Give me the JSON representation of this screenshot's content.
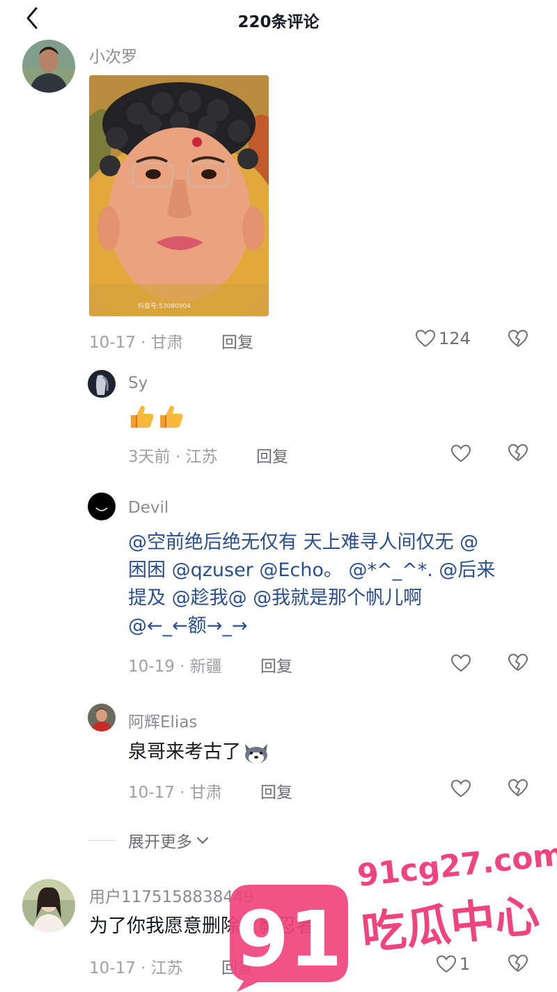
{
  "header": {
    "title": "220条评论"
  },
  "comments": [
    {
      "user": "小次罗",
      "time": "10-17",
      "location": "甘肃",
      "reply_label": "回复",
      "likes": "124",
      "image_watermark": "抖音号:53080904"
    },
    {
      "user": "Sy",
      "emoji": "👍👍",
      "time": "3天前",
      "location": "江苏",
      "reply_label": "回复"
    },
    {
      "user": "Devil",
      "text_lines": [
        "@空前绝后绝无仅有 天上难寻人间仅无 @",
        "困困 @qzuser @Echo。 @*^_^*. @后来",
        "提及 @趁我@ @我就是那个帆儿啊",
        "@←_←额→_→"
      ],
      "time": "10-19",
      "location": "新疆",
      "reply_label": "回复"
    },
    {
      "user": "阿辉Elias",
      "text": "泉哥来考古了",
      "time": "10-17",
      "location": "甘肃",
      "reply_label": "回复"
    },
    {
      "user": "用户1175158838449",
      "text": "为了你我愿意删除火影忍者",
      "time": "10-17",
      "location": "江苏",
      "reply_label": "回复",
      "likes": "1"
    }
  ],
  "expand_label": "展开更多",
  "separator": "·",
  "watermark": {
    "number": "91",
    "domain": "91cg27.com",
    "slogan": "吃瓜中心"
  },
  "colors": {
    "mention": "#2a4f8e",
    "meta": "#9fa0a5",
    "watermark": "#f0447d"
  }
}
